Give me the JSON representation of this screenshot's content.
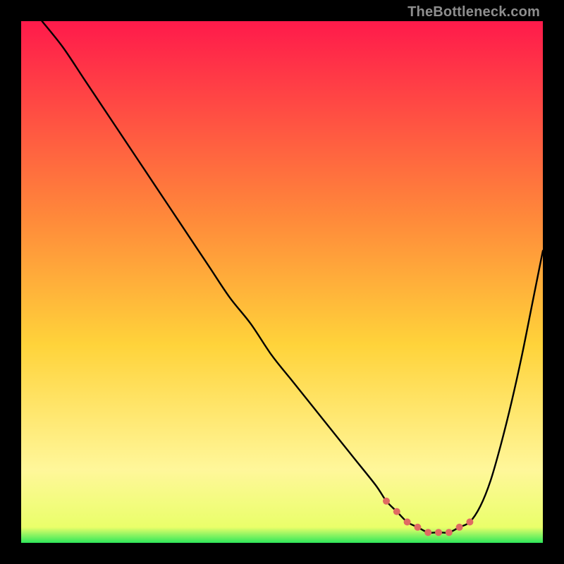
{
  "attribution": "TheBottleneck.com",
  "colors": {
    "gradient_top": "#ff1a4b",
    "gradient_mid_top": "#ff6d3e",
    "gradient_mid": "#ffd33a",
    "gradient_mid_bot": "#fff79a",
    "gradient_bot": "#2ee85a",
    "curve": "#000000",
    "marker": "#e06a62",
    "bg": "#000000"
  },
  "chart_data": {
    "type": "line",
    "title": "",
    "xlabel": "",
    "ylabel": "",
    "xlim": [
      0,
      100
    ],
    "ylim": [
      0,
      100
    ],
    "series": [
      {
        "name": "bottleneck-curve",
        "x": [
          4,
          8,
          12,
          16,
          20,
          24,
          28,
          32,
          36,
          40,
          44,
          48,
          52,
          56,
          60,
          64,
          68,
          70,
          72,
          74,
          76,
          78,
          80,
          82,
          84,
          86,
          88,
          90,
          92,
          94,
          96,
          98,
          100
        ],
        "y": [
          100,
          95,
          89,
          83,
          77,
          71,
          65,
          59,
          53,
          47,
          42,
          36,
          31,
          26,
          21,
          16,
          11,
          8,
          6,
          4,
          3,
          2,
          2,
          2,
          3,
          4,
          7,
          12,
          19,
          27,
          36,
          46,
          56
        ]
      }
    ],
    "markers": {
      "name": "optimal-range",
      "x": [
        70,
        72,
        74,
        76,
        78,
        80,
        82,
        84,
        86
      ],
      "y": [
        8,
        6,
        4,
        3,
        2,
        2,
        2,
        3,
        4
      ]
    }
  }
}
